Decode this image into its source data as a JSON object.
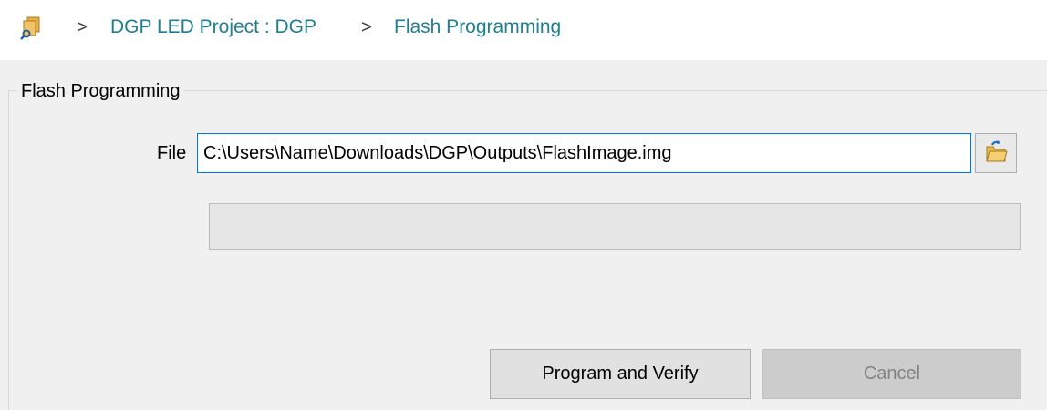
{
  "breadcrumb": {
    "items": [
      {
        "label": "DGP LED Project : DGP"
      },
      {
        "label": "Flash Programming"
      }
    ],
    "separator": ">"
  },
  "panel": {
    "title": "Flash Programming",
    "file_label": "File",
    "file_value": "C:\\Users\\Name\\Downloads\\DGP\\Outputs\\FlashImage.img",
    "progress": 0
  },
  "buttons": {
    "program_label": "Program and Verify",
    "cancel_label": "Cancel"
  },
  "colors": {
    "link": "#1f7e92",
    "input_border": "#0078d7"
  },
  "icons": {
    "breadcrumb": "project-search-icon",
    "browse": "open-folder-icon"
  }
}
